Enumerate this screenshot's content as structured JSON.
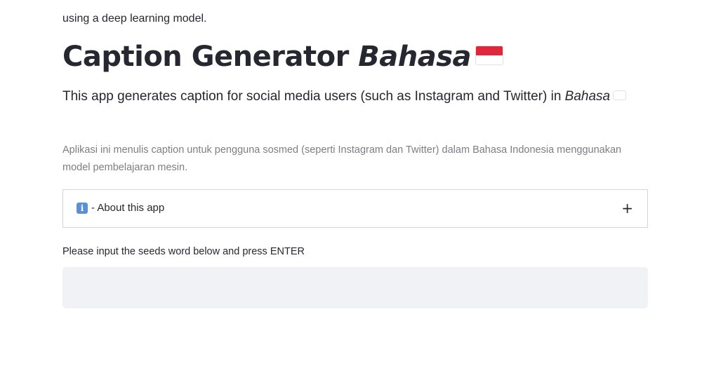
{
  "header": {
    "title_main": "Caption Generator",
    "title_emphasis": "Bahasa",
    "flag_icon": "indonesia-flag-icon",
    "flag_colors": {
      "top": "#e0263b",
      "bottom": "#ffffff"
    }
  },
  "intro": {
    "text_before": "This app generates caption for social media users (such as Instagram and Twitter) in",
    "emphasis": "Bahasa",
    "text_after": "using a deep learning model."
  },
  "caption": {
    "text": "Aplikasi ini menulis caption untuk pengguna sosmed (seperti Instagram dan Twitter) dalam Bahasa Indonesia menggunakan model pembelajaran mesin."
  },
  "expander": {
    "icon": "info-icon",
    "icon_glyph": "i",
    "label": "- About this app",
    "toggle_icon": "plus-icon",
    "toggle_glyph": "+"
  },
  "seed_input": {
    "label": "Please input the seeds word below and press ENTER",
    "value": "",
    "placeholder": ""
  },
  "colors": {
    "text": "#262730",
    "muted": "#7d7d85",
    "input_bg": "#f0f2f6",
    "border": "#d6d6d9"
  }
}
